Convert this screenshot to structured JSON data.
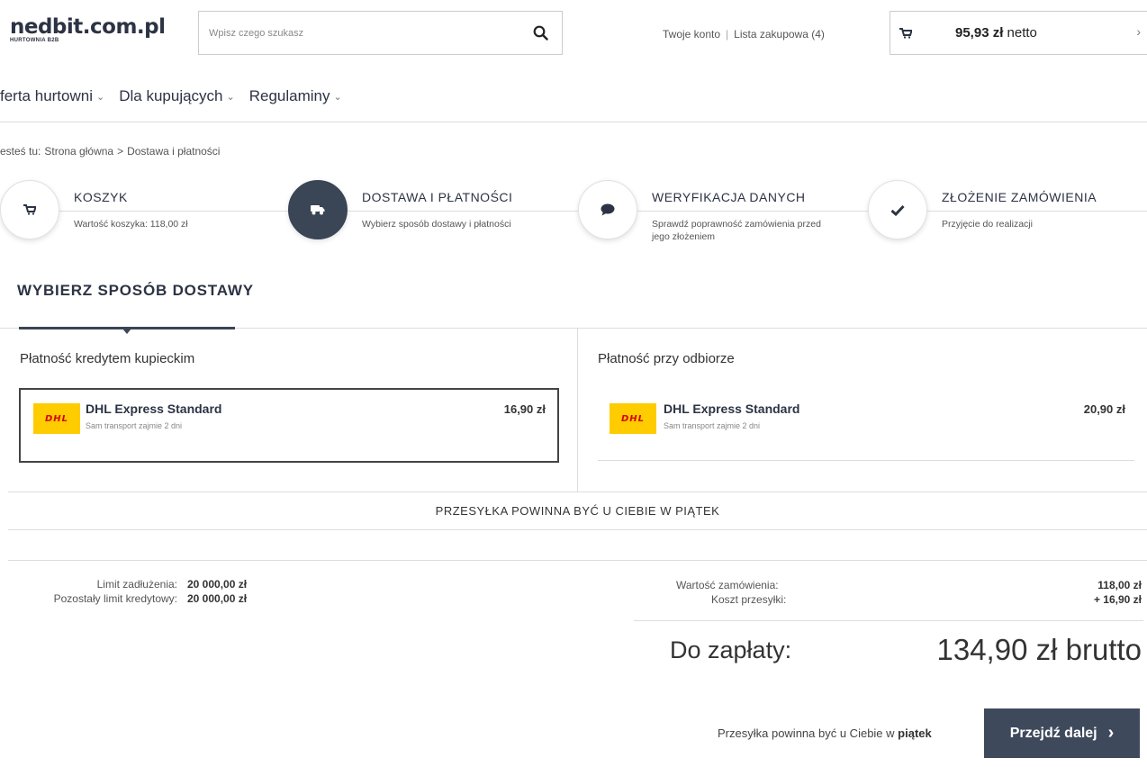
{
  "header": {
    "logo": "nedbit.com.pl",
    "logo_sub": "HURTOWNIA B2B",
    "search_placeholder": "Wpisz czego szukasz",
    "account_link": "Twoje konto",
    "separator": "|",
    "list_link": "Lista zakupowa (4)",
    "cart_amount": "95,93 zł",
    "cart_suffix": " netto",
    "cart_chevron": "›"
  },
  "nav": {
    "items": [
      {
        "label": "ferta hurtowni"
      },
      {
        "label": "Dla kupujących"
      },
      {
        "label": "Regulaminy"
      }
    ],
    "chevron": "⌄"
  },
  "breadcrumb": {
    "prefix": "esteś tu:",
    "home": "Strona główna",
    "sep": ">",
    "current": "Dostawa i płatności"
  },
  "steps": [
    {
      "title": "KOSZYK",
      "desc": "Wartość koszyka: 118,00 zł",
      "icon": "cart-icon"
    },
    {
      "title": "DOSTAWA I PŁATNOŚCI",
      "desc": "Wybierz sposób dostawy i płatności",
      "icon": "truck-icon"
    },
    {
      "title": "WERYFIKACJA DANYCH",
      "desc": "Sprawdź poprawność zamówienia przed jego złożeniem",
      "icon": "chat-icon"
    },
    {
      "title": "ZŁOŻENIE ZAMÓWIENIA",
      "desc": "Przyjęcie do realizacji",
      "icon": "check-icon"
    }
  ],
  "section_title": "WYBIERZ SPOSÓB DOSTAWY",
  "payment_methods": [
    {
      "label": "Płatność kredytem kupieckim",
      "option": {
        "name": "DHL Express Standard",
        "sub": "Sam transport zajmie 2 dni",
        "price": "16,90 zł",
        "logo": "DHL"
      }
    },
    {
      "label": "Płatność przy odbiorze",
      "option": {
        "name": "DHL Express Standard",
        "sub": "Sam transport zajmie 2 dni",
        "price": "20,90 zł",
        "logo": "DHL"
      }
    }
  ],
  "delivery_banner": "PRZESYŁKA POWINNA BYĆ U CIEBIE W PIĄTEK",
  "limits": [
    {
      "label": "Limit zadłużenia:",
      "value": "20 000,00 zł"
    },
    {
      "label": "Pozostały limit kredytowy:",
      "value": "20 000,00 zł"
    }
  ],
  "summary": {
    "order_value_label": "Wartość zamówienia:",
    "order_value": "118,00 zł",
    "shipping_label": "Koszt przesyłki:",
    "shipping_value": "+ 16,90 zł",
    "total_label": "Do zapłaty:",
    "total_value": "134,90 zł brutto"
  },
  "footer": {
    "note_prefix": "Przesyłka powinna być u Ciebie w ",
    "note_day": "piątek",
    "cta_label": "Przejdź dalej",
    "cta_arrow": "›"
  },
  "colors": {
    "accent": "#3e4a5c",
    "dhl_yellow": "#ffcc00",
    "dhl_red": "#d40511"
  }
}
